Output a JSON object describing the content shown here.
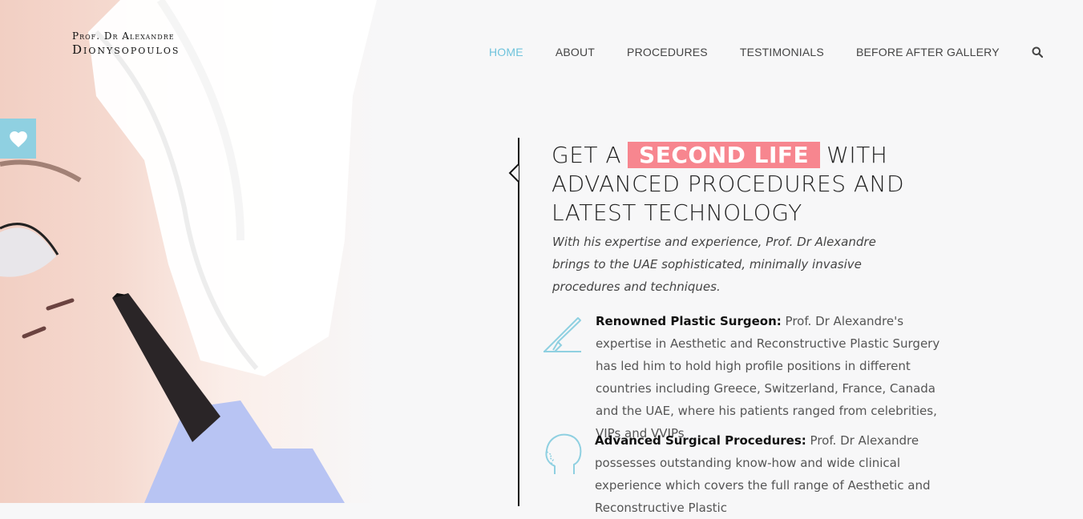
{
  "brand": {
    "line1": "Prof. Dr Alexandre",
    "line2": "Dionysopoulos"
  },
  "nav": {
    "items": [
      {
        "label": "HOME",
        "active": true
      },
      {
        "label": "ABOUT",
        "active": false
      },
      {
        "label": "PROCEDURES",
        "active": false
      },
      {
        "label": "TESTIMONIALS",
        "active": false
      },
      {
        "label": "BEFORE AFTER GALLERY",
        "active": false
      }
    ],
    "search_icon": "search-icon"
  },
  "favorite_tab": {
    "icon": "heart-icon"
  },
  "hero": {
    "headline_before": "GET A",
    "headline_highlight": "SECOND LIFE",
    "headline_after": "WITH ADVANCED PROCEDURES AND LATEST TECHNOLOGY",
    "lead": "With his expertise and experience, Prof. Dr Alexandre brings to the UAE sophisticated, minimally invasive procedures and techniques."
  },
  "features": [
    {
      "icon": "scalpel-icon",
      "title": "Renowned Plastic Surgeon:",
      "text": "Prof. Dr Alexandre's expertise in Aesthetic and Reconstructive Plastic Surgery has led him to hold high profile positions in different countries including Greece, Switzerland, France, Canada and the UAE, where his patients ranged from celebrities, VIPs and VVIPs"
    },
    {
      "icon": "head-profile-icon",
      "title": "Advanced Surgical Procedures:",
      "text": "Prof. Dr Alexandre possesses outstanding know-how and wide clinical experience which covers the full range of Aesthetic and Reconstructive Plastic"
    }
  ],
  "colors": {
    "accent": "#6fc3dc",
    "highlight": "#f7868f",
    "tab": "#8fd0e1"
  }
}
